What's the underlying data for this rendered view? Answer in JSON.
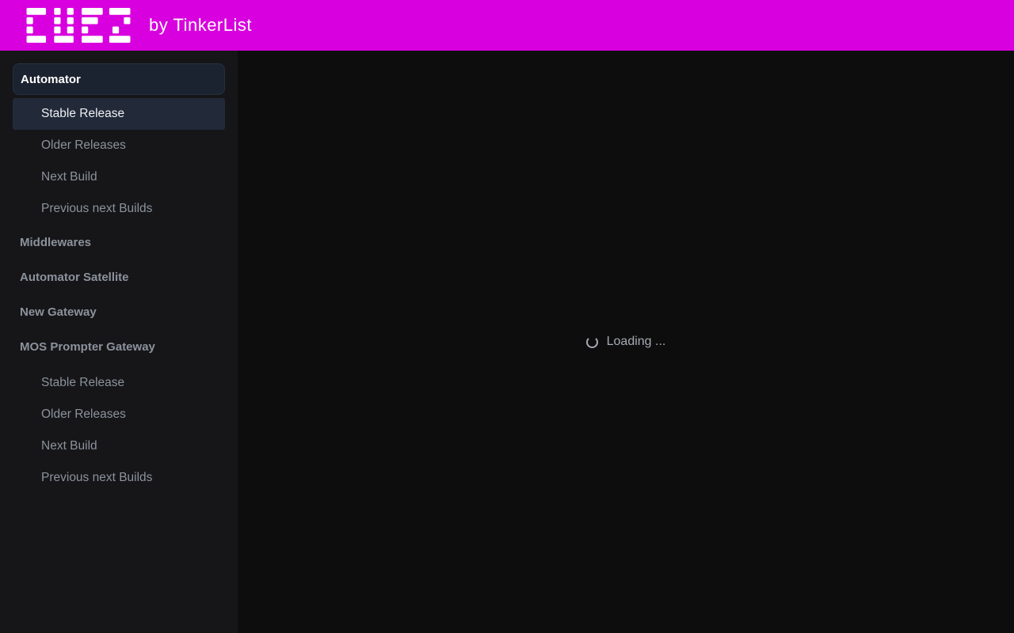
{
  "header": {
    "logo_name": "CUEZ",
    "byline": "by TinkerList"
  },
  "sidebar": {
    "items": [
      {
        "label": "Automator",
        "level": "section",
        "active": true
      },
      {
        "label": "Stable Release",
        "level": "sub",
        "active": true
      },
      {
        "label": "Older Releases",
        "level": "sub",
        "active": false
      },
      {
        "label": "Next Build",
        "level": "sub",
        "active": false
      },
      {
        "label": "Previous next Builds",
        "level": "sub",
        "active": false
      },
      {
        "label": "Middlewares",
        "level": "section",
        "active": false
      },
      {
        "label": "Automator Satellite",
        "level": "section",
        "active": false
      },
      {
        "label": "New Gateway",
        "level": "section",
        "active": false
      },
      {
        "label": "MOS Prompter Gateway",
        "level": "section",
        "active": false
      },
      {
        "label": "Stable Release",
        "level": "sub",
        "active": false
      },
      {
        "label": "Older Releases",
        "level": "sub",
        "active": false
      },
      {
        "label": "Next Build",
        "level": "sub",
        "active": false
      },
      {
        "label": "Previous next Builds",
        "level": "sub",
        "active": false
      }
    ]
  },
  "main": {
    "loading_text": "Loading ..."
  },
  "colors": {
    "header_bg": "#d800de",
    "sidebar_bg": "#161619",
    "main_bg": "#0d0d0e",
    "active_section_bg": "#1c2330",
    "active_sub_bg": "#222a39",
    "active_text": "#ffffff",
    "inactive_text": "#8c929c",
    "loading_text": "#a6abb3",
    "logo_color": "#ffffff"
  }
}
